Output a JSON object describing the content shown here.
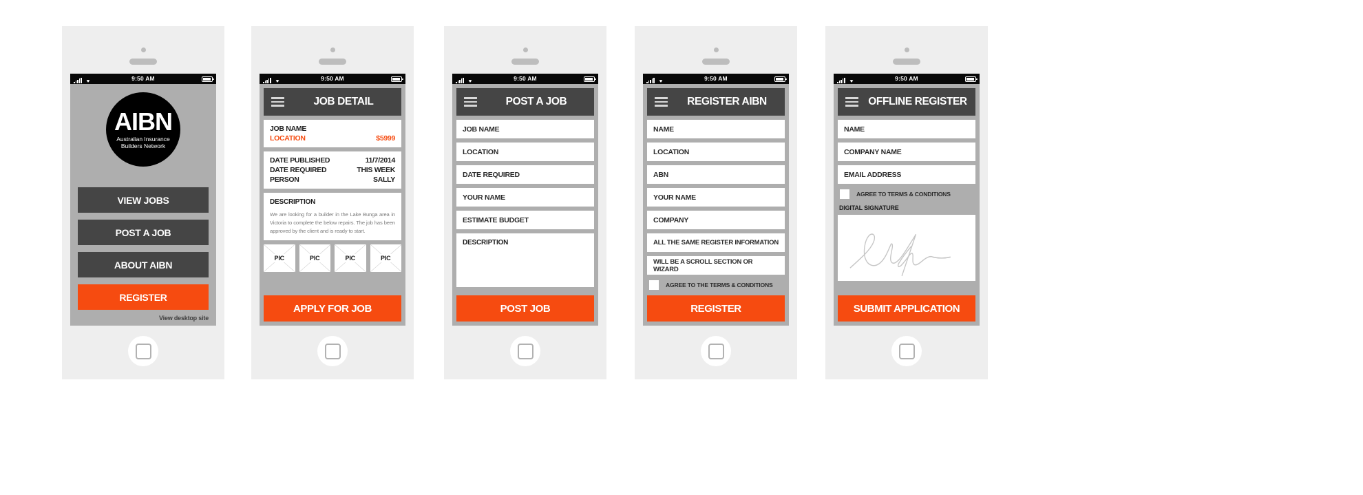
{
  "statusbar": {
    "time": "9:50 AM",
    "signal_icon": "signal-bars-icon",
    "wifi_icon": "wifi-icon",
    "battery_icon": "battery-icon"
  },
  "screens": [
    {
      "id": "home",
      "logo": {
        "acronym": "AIBN",
        "line1": "Australian Insurance",
        "line2": "Builders Network"
      },
      "buttons": [
        {
          "label": "VIEW JOBS",
          "style": "dark"
        },
        {
          "label": "POST A JOB",
          "style": "dark"
        },
        {
          "label": "ABOUT AIBN",
          "style": "dark"
        },
        {
          "label": "REGISTER",
          "style": "primary"
        }
      ],
      "desktop_link": "View desktop site"
    },
    {
      "id": "job-detail",
      "title": "JOB DETAIL",
      "summary": {
        "job_name": "JOB NAME",
        "location": "LOCATION",
        "price": "$5999"
      },
      "meta": [
        {
          "label": "DATE PUBLISHED",
          "value": "11/7/2014"
        },
        {
          "label": "DATE REQUIRED",
          "value": "THIS WEEK"
        },
        {
          "label": "PERSON",
          "value": "SALLY"
        }
      ],
      "description": {
        "title": "DESCRIPTION",
        "body": "We are looking for a builder in the Lake Bunga area in Victoria to complete the below repairs. The job has been approved by the client and is ready to start."
      },
      "pics": [
        "PIC",
        "PIC",
        "PIC",
        "PIC"
      ],
      "cta": "APPLY FOR JOB"
    },
    {
      "id": "post-a-job",
      "title": "POST A JOB",
      "fields": [
        "JOB NAME",
        "LOCATION",
        "DATE REQUIRED",
        "YOUR NAME",
        "ESTIMATE BUDGET"
      ],
      "description_label": "DESCRIPTION",
      "cta": "POST JOB"
    },
    {
      "id": "register-aibn",
      "title": "REGISTER AIBN",
      "fields": [
        "NAME",
        "LOCATION",
        "ABN",
        "YOUR NAME",
        "COMPANY",
        "ALL THE SAME REGISTER INFORMATION",
        "WILL BE A SCROLL SECTION  OR WIZARD"
      ],
      "terms_label": "AGREE TO THE TERMS & CONDITIONS",
      "cta": "REGISTER"
    },
    {
      "id": "offline-register",
      "title": "OFFLINE REGISTER",
      "fields": [
        "NAME",
        "COMPANY NAME",
        "EMAIL ADDRESS"
      ],
      "terms_label": "AGREE TO TERMS & CONDITIONS",
      "signature_label": "DIGITAL SIGNATURE",
      "signature_icon": "handwritten-signature-icon",
      "cta": "SUBMIT APPLICATION"
    }
  ],
  "colors": {
    "accent": "#f64b10",
    "dark": "#454545",
    "screen_bg": "#aeaeae",
    "frame": "#eeeeee"
  }
}
